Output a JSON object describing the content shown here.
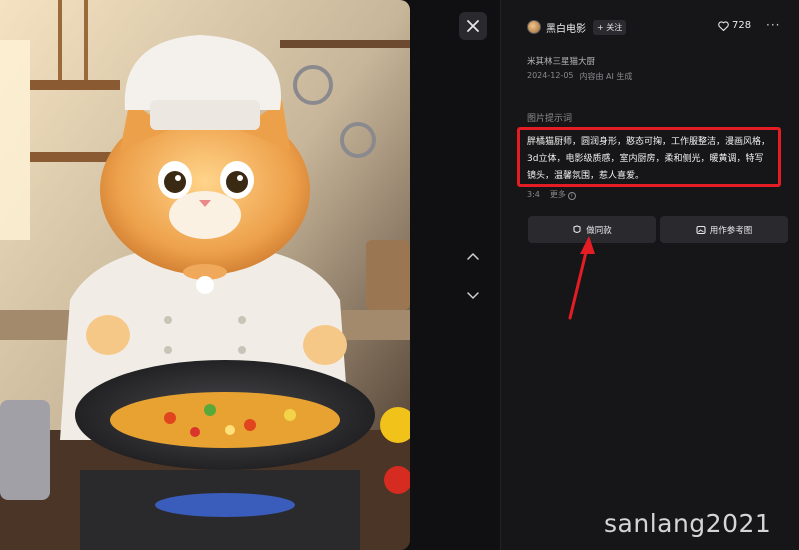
{
  "image": {
    "alt_icon": "chef-cat-image"
  },
  "nav": {
    "close_icon": "close-icon",
    "up_icon": "chevron-up-icon",
    "down_icon": "chevron-down-icon"
  },
  "author": {
    "name": "黑白电影",
    "follow_label": "+ 关注"
  },
  "likes": {
    "count": "728"
  },
  "more_label": "···",
  "work": {
    "title": "米其林三星猫大厨",
    "date": "2024-12-05",
    "ai_note": "内容由 AI 生成"
  },
  "prompt": {
    "label": "图片提示词",
    "text": "胖橘猫厨师，圆润身形，憨态可掬，工作服整洁，漫画风格，3d立体，电影级质感，室内厨房，柔和侧光，暖黄调，特写镜头，温馨氛围，惹人喜爱。"
  },
  "details": {
    "ratio": "3:4",
    "more": "更多"
  },
  "actions": {
    "same_label": "做同款",
    "ref_label": "用作参考图"
  },
  "watermark": "sanlang2021",
  "colors": {
    "highlight_box": "#e41d24",
    "arrow": "#e41d24"
  }
}
